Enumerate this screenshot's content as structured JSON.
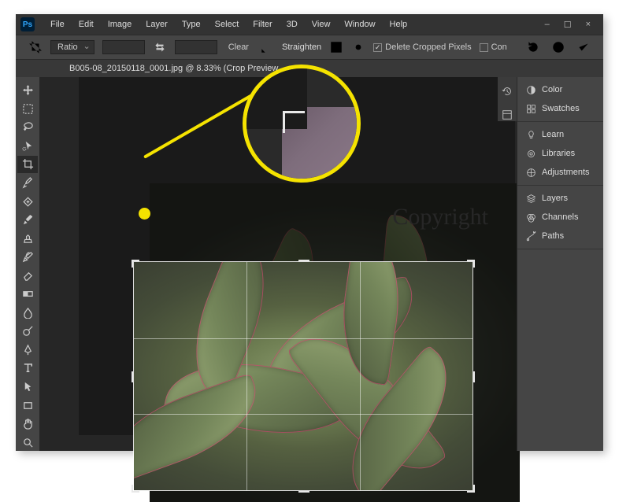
{
  "app": {
    "logo_text": "Ps"
  },
  "menu": {
    "items": [
      "File",
      "Edit",
      "Image",
      "Layer",
      "Type",
      "Select",
      "Filter",
      "3D",
      "View",
      "Window",
      "Help"
    ]
  },
  "window_controls": {
    "minimize": "–",
    "maximize": "☐",
    "close": "×"
  },
  "options": {
    "ratio_label": "Ratio",
    "clear_label": "Clear",
    "straighten_label": "Straighten",
    "delete_cropped_label": "Delete Cropped Pixels",
    "delete_cropped_checked": "✓",
    "content_aware_label": "Con"
  },
  "document": {
    "tab_title": "B005-08_20150118_0001.jpg @ 8.33% (Crop Preview,"
  },
  "canvas": {
    "watermark": "Copyright"
  },
  "tools": [
    "move-tool",
    "marquee-tool",
    "lasso-tool",
    "quick-select-tool",
    "crop-tool",
    "eyedropper-tool",
    "spot-heal-tool",
    "brush-tool",
    "clone-stamp-tool",
    "history-brush-tool",
    "eraser-tool",
    "gradient-tool",
    "blur-tool",
    "dodge-tool",
    "pen-tool",
    "type-tool",
    "path-select-tool",
    "rectangle-tool",
    "hand-tool",
    "zoom-tool"
  ],
  "panels": {
    "group1": [
      {
        "icon": "color-wheel-icon",
        "label": "Color"
      },
      {
        "icon": "swatches-icon",
        "label": "Swatches"
      }
    ],
    "group2": [
      {
        "icon": "lightbulb-icon",
        "label": "Learn"
      },
      {
        "icon": "cc-libraries-icon",
        "label": "Libraries"
      },
      {
        "icon": "adjustments-icon",
        "label": "Adjustments"
      }
    ],
    "group3": [
      {
        "icon": "layers-icon",
        "label": "Layers"
      },
      {
        "icon": "channels-icon",
        "label": "Channels"
      },
      {
        "icon": "paths-icon",
        "label": "Paths"
      }
    ]
  },
  "right_strip": [
    "history-icon",
    "properties-icon"
  ]
}
